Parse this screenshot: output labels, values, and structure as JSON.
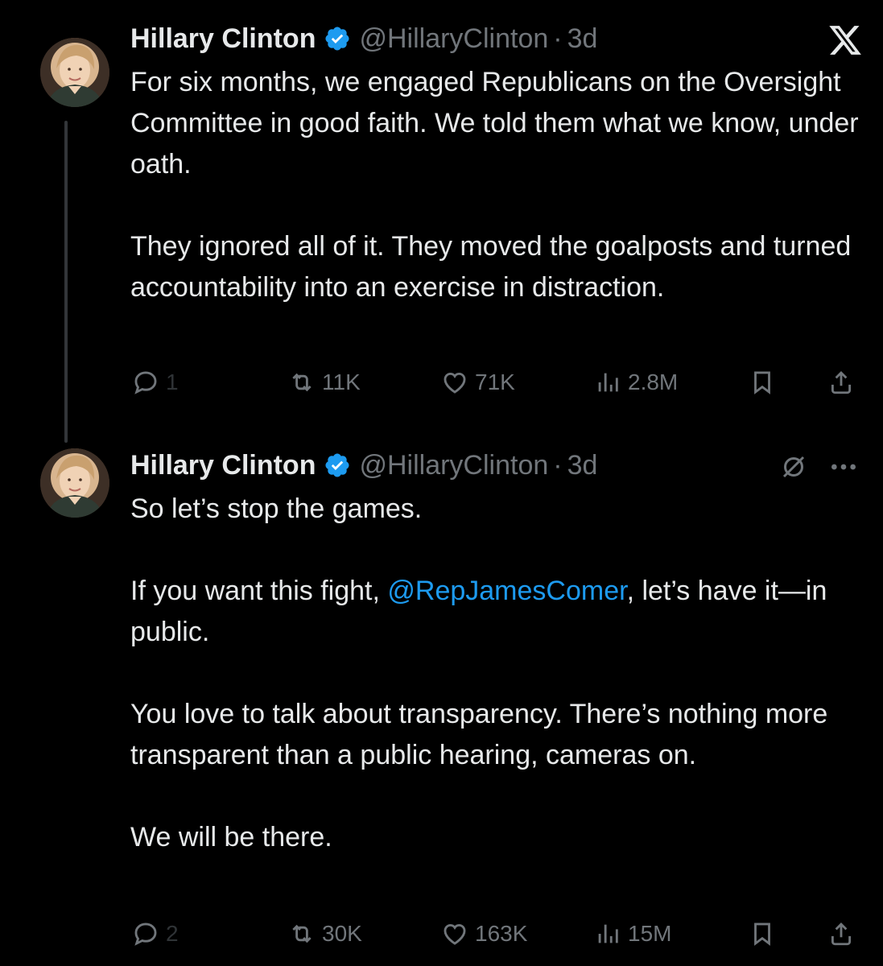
{
  "tweets": [
    {
      "author": {
        "name": "Hillary Clinton",
        "handle": "@HillaryClinton",
        "separator": "·",
        "time": "3d"
      },
      "paragraphs": [
        "For six months, we engaged Republicans on the Oversight Committee in good faith. We told them what we know, under oath.",
        "They ignored all of it. They moved the goalposts and turned accountability into an exercise in distraction."
      ],
      "actions": {
        "replies": "1",
        "reposts": "11K",
        "likes": "71K",
        "views": "2.8M"
      }
    },
    {
      "author": {
        "name": "Hillary Clinton",
        "handle": "@HillaryClinton",
        "separator": "·",
        "time": "3d"
      },
      "paragraphs": [
        "So let’s stop the games."
      ],
      "para2": {
        "before": "If you want this fight, ",
        "mention": "@RepJamesComer",
        "after": ", let’s have it—in public."
      },
      "paragraphs_after": [
        "You love to talk about transparency. There’s nothing more transparent than a public hearing, cameras on.",
        "We will be there."
      ],
      "actions": {
        "replies": "2",
        "reposts": "30K",
        "likes": "163K",
        "views": "15M"
      }
    }
  ],
  "icons": {
    "app": "x-logo-icon",
    "verified": "verified-badge-icon",
    "grok": "grok-icon",
    "more": "more-icon",
    "reply": "reply-icon",
    "repost": "repost-icon",
    "like": "heart-icon",
    "views": "views-icon",
    "bookmark": "bookmark-icon",
    "share": "share-icon"
  },
  "colors": {
    "background": "#000000",
    "text": "#e7e9ea",
    "muted": "#71767b",
    "accent": "#1d9bf0"
  }
}
